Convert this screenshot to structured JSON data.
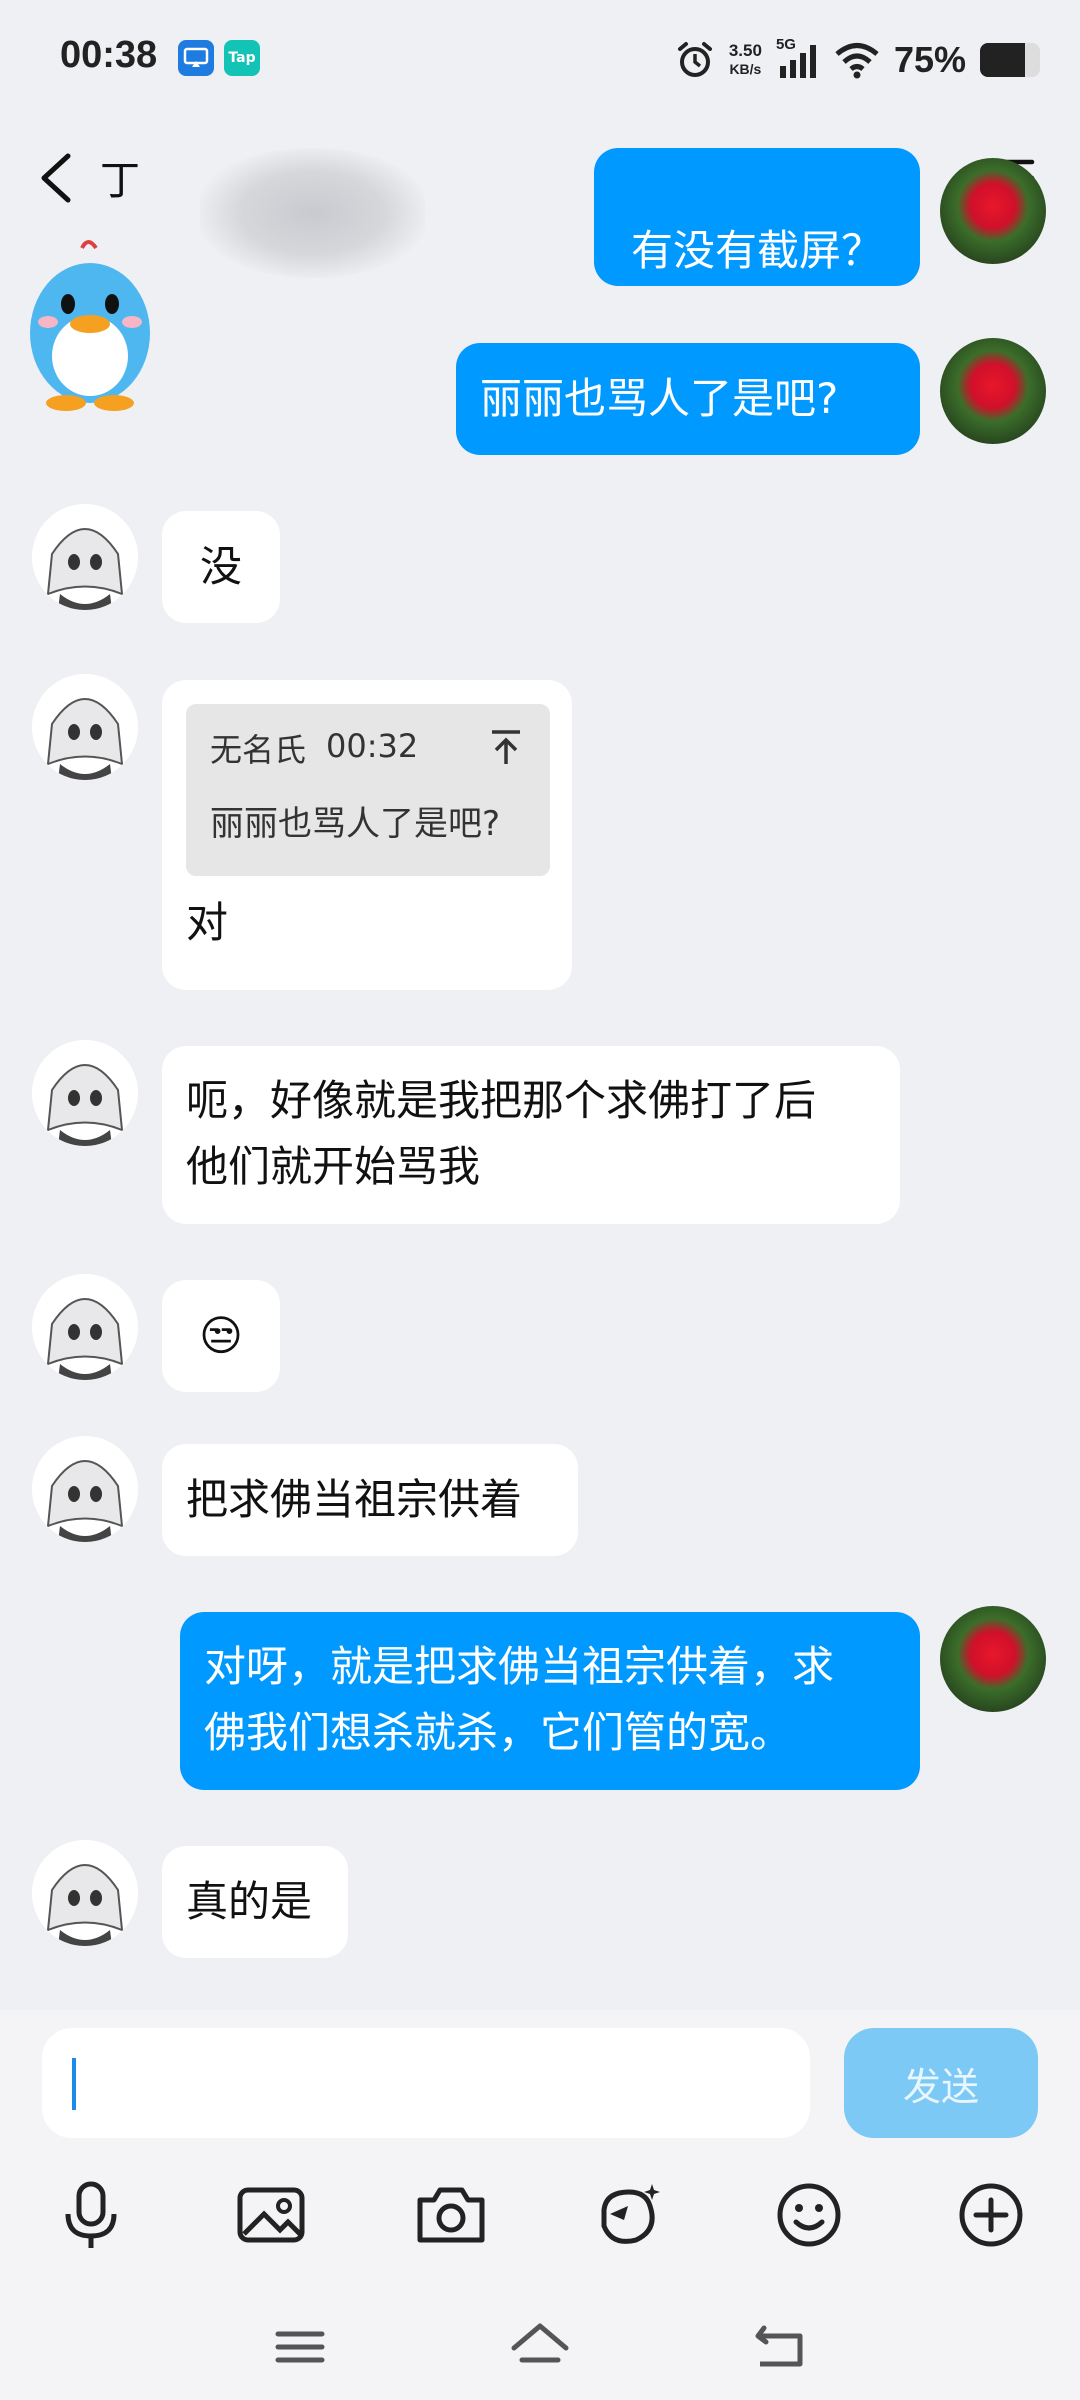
{
  "status": {
    "time": "00:38",
    "app_icon_tap": "Tap",
    "net_speed_value": "3.50",
    "net_speed_unit": "KB/s",
    "network": "5G",
    "battery_percent": "75%",
    "battery_level": 0.75
  },
  "header": {
    "contact_name": "丁"
  },
  "messages": [
    {
      "id": "m0",
      "side": "out",
      "text": "有没有截屏？"
    },
    {
      "id": "m1",
      "side": "out",
      "text": "丽丽也骂人了是吧?"
    },
    {
      "id": "m2",
      "side": "in",
      "text": "没"
    },
    {
      "id": "m3",
      "side": "in",
      "quote_author": "无名氏",
      "quote_time": "00:32",
      "quote_text": "丽丽也骂人了是吧?",
      "text": "对"
    },
    {
      "id": "m4",
      "side": "in",
      "text_line1": "呃，好像就是我把那个求佛打了后",
      "text_line2": "他们就开始骂我"
    },
    {
      "id": "m5",
      "side": "in",
      "text": "😒"
    },
    {
      "id": "m6",
      "side": "in",
      "text": "把求佛当祖宗供着"
    },
    {
      "id": "m7",
      "side": "out",
      "text_line1": "对呀，就是把求佛当祖宗供着，求",
      "text_line2": "佛我们想杀就杀，它们管的宽。"
    },
    {
      "id": "m8",
      "side": "in",
      "text": "真的是"
    }
  ],
  "input": {
    "placeholder": "",
    "value": "",
    "send_label": "发送"
  },
  "colors": {
    "accent": "#0099ff",
    "background": "#eff0f4",
    "send_disabled": "#7cc9f5"
  },
  "icons": [
    "back-arrow-icon",
    "menu-icon",
    "microphone-icon",
    "image-icon",
    "camera-icon",
    "sticker-icon",
    "emoji-icon",
    "add-icon",
    "nav-menu-icon",
    "nav-home-icon",
    "nav-back-icon"
  ]
}
